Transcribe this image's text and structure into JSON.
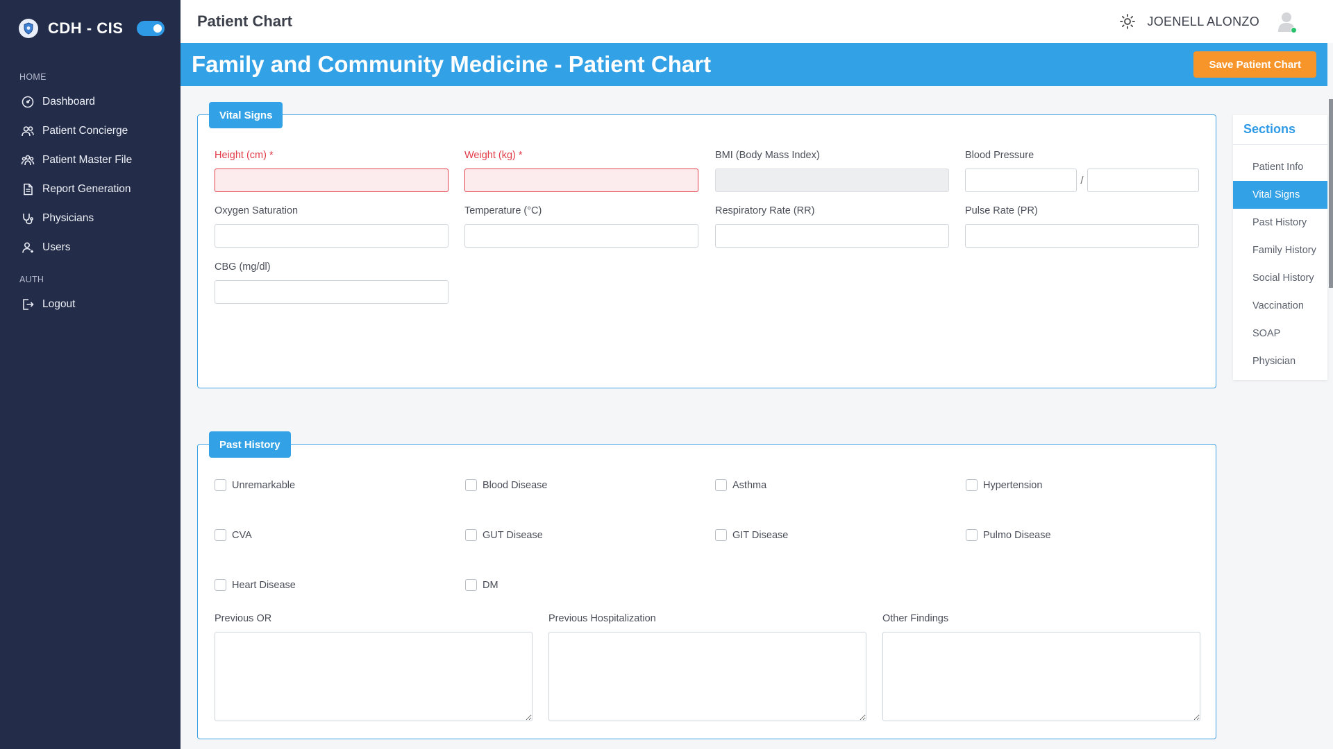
{
  "sidebar": {
    "brand": "CDH - CIS",
    "home_header": "HOME",
    "auth_header": "AUTH",
    "items": [
      {
        "label": "Dashboard",
        "icon": "dashboard-icon"
      },
      {
        "label": "Patient Concierge",
        "icon": "users-icon"
      },
      {
        "label": "Patient Master File",
        "icon": "group-icon"
      },
      {
        "label": "Report Generation",
        "icon": "document-icon"
      },
      {
        "label": "Physicians",
        "icon": "stethoscope-icon"
      },
      {
        "label": "Users",
        "icon": "user-icon"
      }
    ],
    "logout": {
      "label": "Logout",
      "icon": "logout-icon"
    }
  },
  "topbar": {
    "title": "Patient Chart",
    "user_name": "JOENELL ALONZO"
  },
  "banner": {
    "title": "Family and Community Medicine - Patient Chart",
    "save_label": "Save Patient Chart"
  },
  "vitals": {
    "tag": "Vital Signs",
    "height_label": "Height (cm)",
    "weight_label": "Weight (kg)",
    "required_mark": "*",
    "bmi_label": "BMI (Body Mass Index)",
    "bp_label": "Blood Pressure",
    "bp_sep": "/",
    "oxygen_label": "Oxygen Saturation",
    "temp_label": "Temperature (°C)",
    "rr_label": "Respiratory Rate (RR)",
    "pr_label": "Pulse Rate (PR)",
    "cbg_label": "CBG (mg/dl)"
  },
  "past": {
    "tag": "Past History",
    "checks": [
      "Unremarkable",
      "Blood Disease",
      "Asthma",
      "Hypertension",
      "CVA",
      "GUT Disease",
      "GIT Disease",
      "Pulmo Disease",
      "Heart Disease",
      "DM"
    ],
    "previous_or": "Previous OR",
    "previous_hosp": "Previous Hospitalization",
    "other_findings": "Other Findings"
  },
  "sections": {
    "title": "Sections",
    "items": [
      "Patient Info",
      "Vital Signs",
      "Past History",
      "Family History",
      "Social History",
      "Vaccination",
      "SOAP",
      "Physician"
    ],
    "active": "Vital Signs"
  },
  "colors": {
    "sidebar_bg": "#232c48",
    "accent": "#33a1e6",
    "save_button": "#f7952b",
    "required": "#e23b48"
  }
}
